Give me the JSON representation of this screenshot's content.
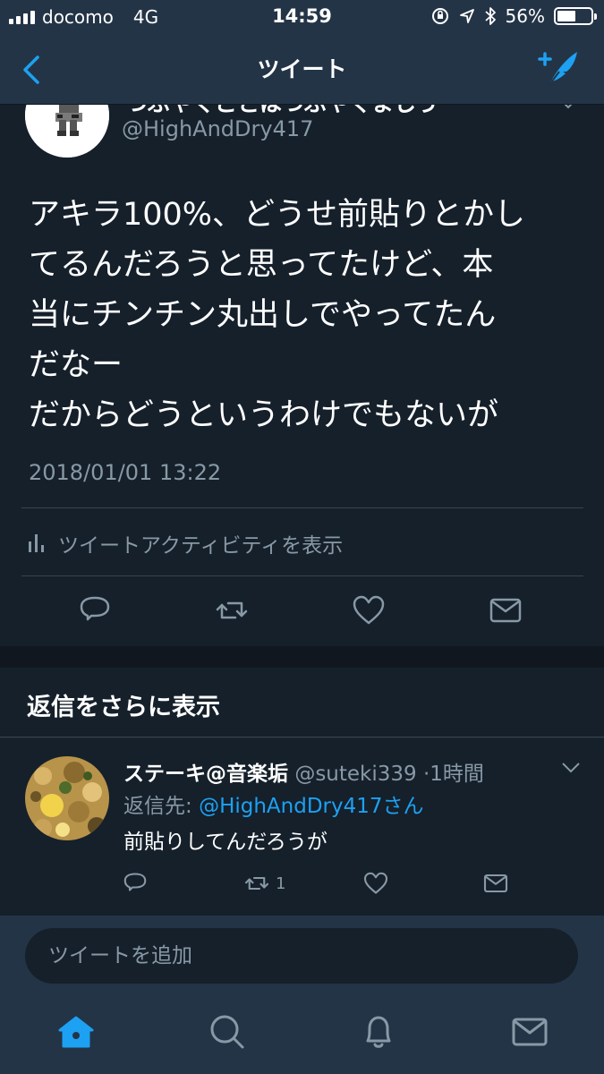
{
  "status_bar": {
    "carrier": "docomo",
    "network": "4G",
    "time": "14:59",
    "battery": "56%",
    "battery_level": 0.56
  },
  "nav": {
    "title": "ツイート"
  },
  "tweet": {
    "display_name_clipped": "つぶやくことはつぶやくましう",
    "handle": "@HighAndDry417",
    "lines": [
      "アキラ100%、どうせ前貼りとかし",
      "てるんだろうと思ってたけど、本",
      "当にチンチン丸出しでやってたん",
      "だなー",
      "だからどうというわけでもないが"
    ],
    "date": "2018/01/01 13:22",
    "activity_label": "ツイートアクティビティを表示"
  },
  "more_replies": {
    "label": "返信をさらに表示"
  },
  "reply": {
    "name": "ステーキ@音楽垢",
    "handle": "@suteki339",
    "separator": "·",
    "time": "1時間",
    "reply_to_prefix": "返信先: ",
    "reply_to_mention": "@HighAndDry417さん",
    "text": "前貼りしてんだろうが",
    "retweet_count": "1"
  },
  "compose": {
    "placeholder": "ツイートを追加"
  },
  "colors": {
    "accent": "#1da1f2",
    "background": "#15202b",
    "bar": "#243447",
    "muted": "#8899a6",
    "divider": "#38444d"
  },
  "icons": [
    "back-chevron-icon",
    "compose-tweet-icon",
    "reply-icon",
    "retweet-icon",
    "like-icon",
    "dm-icon",
    "home-icon",
    "search-icon",
    "notifications-icon",
    "messages-icon"
  ]
}
